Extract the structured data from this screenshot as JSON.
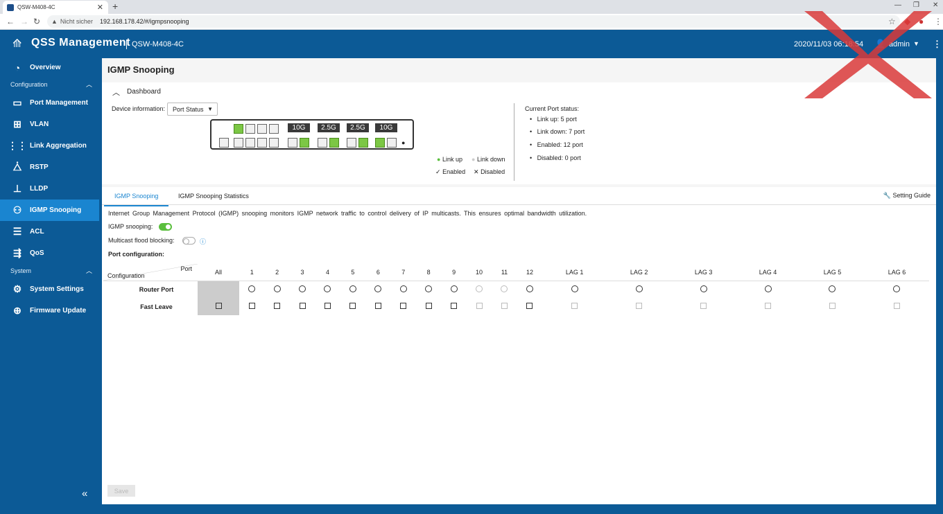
{
  "browser": {
    "tab_title": "QSW-M408-4C",
    "insecure_label": "Nicht sicher",
    "url": "192.168.178.42/#/igmpsnooping"
  },
  "header": {
    "app_title": "QSS Management",
    "device": "QSW-M408-4C",
    "datetime": "2020/11/03 06:18:54",
    "user": "admin"
  },
  "sidebar": {
    "items": [
      {
        "label": "Overview",
        "icon": "overview-icon"
      },
      {
        "label": "Port Management",
        "icon": "port-icon"
      },
      {
        "label": "VLAN",
        "icon": "vlan-icon"
      },
      {
        "label": "Link Aggregation",
        "icon": "link-aggregation-icon"
      },
      {
        "label": "RSTP",
        "icon": "rstp-icon"
      },
      {
        "label": "LLDP",
        "icon": "lldp-icon"
      },
      {
        "label": "IGMP Snooping",
        "icon": "igmp-icon"
      },
      {
        "label": "ACL",
        "icon": "acl-icon"
      },
      {
        "label": "QoS",
        "icon": "qos-icon"
      },
      {
        "label": "System Settings",
        "icon": "gear-icon"
      },
      {
        "label": "Firmware Update",
        "icon": "firmware-icon"
      }
    ],
    "sections": {
      "configuration": "Configuration",
      "system": "System"
    }
  },
  "page": {
    "title": "IGMP Snooping",
    "dashboard": "Dashboard",
    "device_info_label": "Device information:",
    "device_info_select": "Port Status",
    "port_labels": [
      "10G",
      "2.5G",
      "2.5G",
      "10G"
    ],
    "legend": {
      "link_up": "Link up",
      "link_down": "Link down",
      "enabled": "Enabled",
      "disabled": "Disabled"
    },
    "status": {
      "title": "Current Port status:",
      "link_up": "Link up:   5 port",
      "link_down": "Link down:   7 port",
      "enabled": "Enabled:   12 port",
      "disabled": "Disabled:   0 port"
    }
  },
  "tabs": [
    "IGMP Snooping",
    "IGMP Snooping Statistics"
  ],
  "setting_guide": "Setting Guide",
  "description": "Internet Group Management Protocol (IGMP) snooping monitors IGMP network traffic to control delivery of IP multicasts. This ensures optimal bandwidth utilization.",
  "fields": {
    "igmp_snooping": "IGMP snooping:",
    "flood_blocking": "Multicast flood blocking:",
    "port_config": "Port configuration:"
  },
  "table": {
    "port_header": "Port",
    "config_header": "Configuration",
    "columns": [
      "All",
      "1",
      "2",
      "3",
      "4",
      "5",
      "6",
      "7",
      "8",
      "9",
      "10",
      "11",
      "12",
      "LAG 1",
      "LAG 2",
      "LAG 3",
      "LAG 4",
      "LAG 5",
      "LAG 6"
    ],
    "rows": [
      "Router Port",
      "Fast Leave"
    ]
  },
  "save_label": "Save"
}
